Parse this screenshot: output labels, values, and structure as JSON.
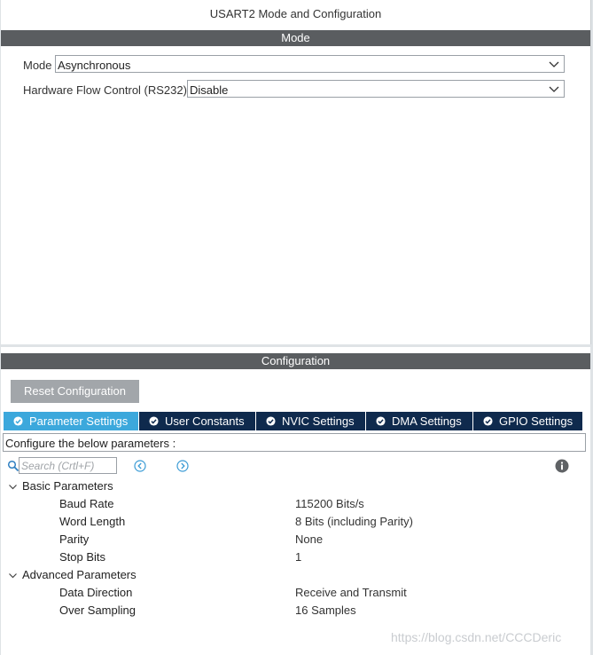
{
  "window": {
    "title": "USART2 Mode and Configuration"
  },
  "mode_section": {
    "header": "Mode",
    "mode_label": "Mode",
    "mode_value": "Asynchronous",
    "flow_label": "Hardware Flow Control (RS232)",
    "flow_value": "Disable"
  },
  "config_section": {
    "header": "Configuration",
    "reset_label": "Reset Configuration",
    "tabs": [
      {
        "label": "Parameter Settings",
        "active": true
      },
      {
        "label": "User Constants",
        "active": false
      },
      {
        "label": "NVIC Settings",
        "active": false
      },
      {
        "label": "DMA Settings",
        "active": false
      },
      {
        "label": "GPIO Settings",
        "active": false
      }
    ],
    "description": "Configure the below parameters :",
    "search_placeholder": "Search (Crtl+F)"
  },
  "parameters": {
    "basic": {
      "label": "Basic Parameters",
      "items": [
        {
          "name": "Baud Rate",
          "value": "115200 Bits/s"
        },
        {
          "name": "Word Length",
          "value": "8 Bits (including Parity)"
        },
        {
          "name": "Parity",
          "value": "None"
        },
        {
          "name": "Stop Bits",
          "value": "1"
        }
      ]
    },
    "advanced": {
      "label": "Advanced Parameters",
      "items": [
        {
          "name": "Data Direction",
          "value": "Receive and Transmit"
        },
        {
          "name": "Over Sampling",
          "value": "16 Samples"
        }
      ]
    }
  },
  "watermark": "https://blog.csdn.net/CCCDeric",
  "colors": {
    "section_bar": "#5a5d60",
    "tab_active": "#3ca8dc",
    "tab_inactive": "#0f2a4d",
    "button_gray": "#a2a6aa",
    "nav_blue": "#3a9bd5"
  },
  "icons": {
    "dropdown": "chevron-down-icon",
    "tab_status": "check-circle-icon",
    "search": "search-icon",
    "nav_back": "circle-arrow-left-icon",
    "nav_forward": "circle-arrow-right-icon",
    "info": "info-icon",
    "tree": "chevron-down-icon"
  }
}
